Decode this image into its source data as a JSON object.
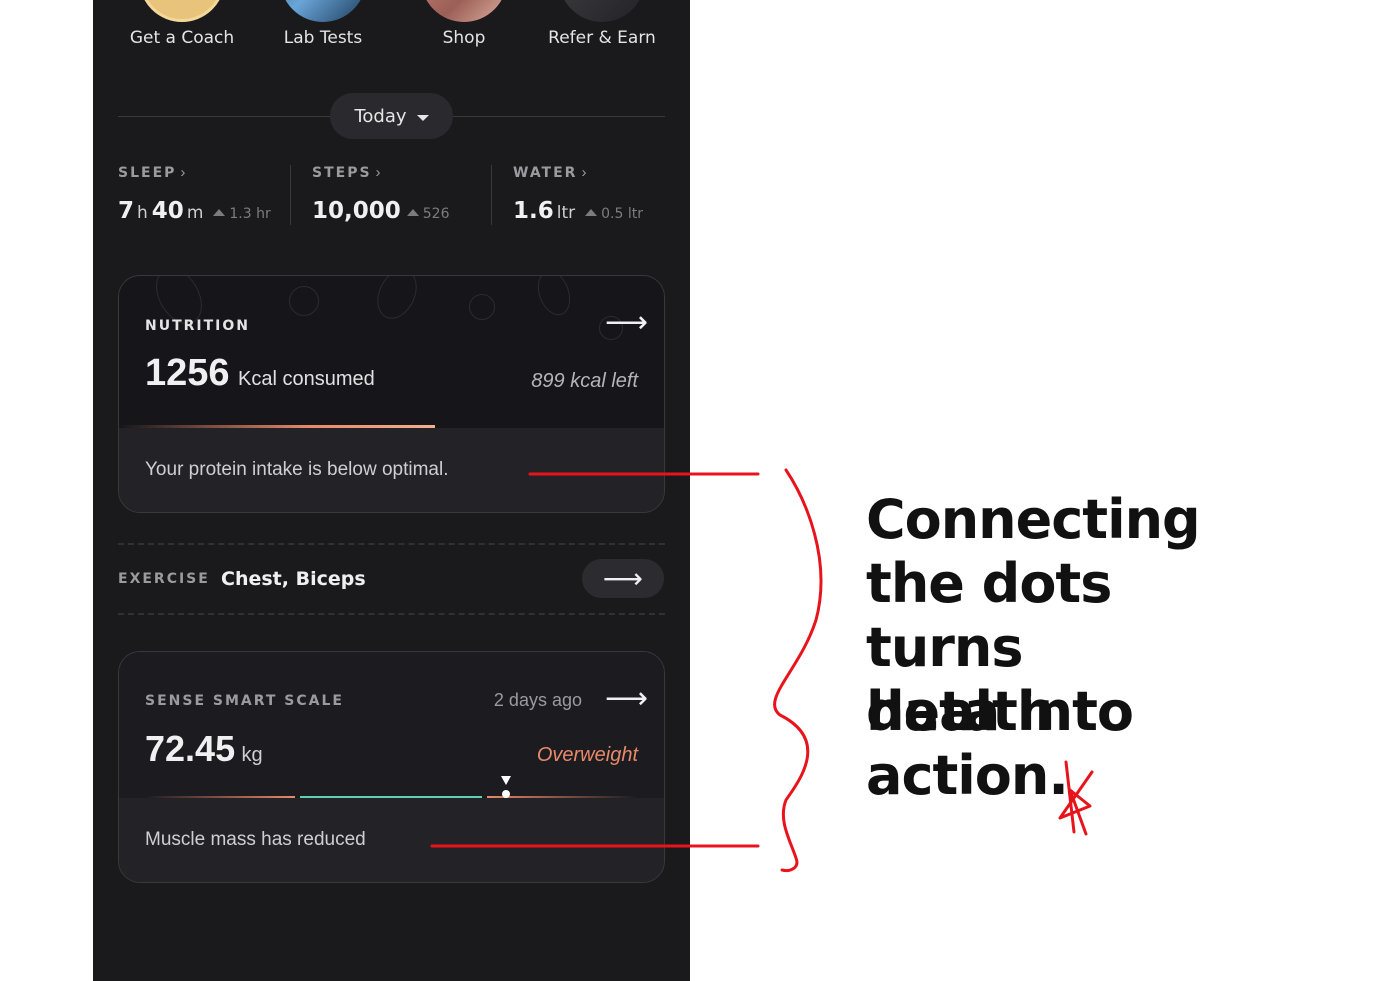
{
  "shortcuts": [
    {
      "label": "Get a Coach",
      "icon": "coach-avatar-icon",
      "color": "#e8c37b"
    },
    {
      "label": "Lab Tests",
      "icon": "lab-tests-icon",
      "color": "#4a7fb3"
    },
    {
      "label": "Shop",
      "icon": "shop-icon",
      "color": "#c87a6a"
    },
    {
      "label": "Refer & Earn",
      "icon": "refer-earn-icon",
      "color": "#3a3a3e"
    }
  ],
  "date_filter": {
    "label": "Today"
  },
  "stats": {
    "sleep": {
      "title": "SLEEP",
      "hours": "7",
      "h_unit": "h",
      "minutes": "40",
      "m_unit": "m",
      "delta": "1.3 hr"
    },
    "steps": {
      "title": "STEPS",
      "value": "10,000",
      "delta": "526"
    },
    "water": {
      "title": "WATER",
      "value": "1.6",
      "unit": "ltr",
      "delta": "0.5 ltr"
    }
  },
  "nutrition": {
    "title": "NUTRITION",
    "consumed": "1256",
    "consumed_label": "Kcal consumed",
    "left_label": "899 kcal left",
    "progress": 0.58,
    "insight": "Your protein intake is below optimal."
  },
  "exercise": {
    "title": "EXERCISE",
    "value": "Chest, Biceps"
  },
  "scale": {
    "title": "SENSE SMART SCALE",
    "when": "2 days ago",
    "weight": "72.45",
    "unit": "kg",
    "status": "Overweight",
    "insight": "Muscle mass has reduced"
  },
  "annotation": {
    "lines": [
      "Connecting",
      "the dots",
      "turns health",
      "data into",
      "action."
    ]
  },
  "colors": {
    "annotation_red": "#e8141c",
    "status_orange": "#e8896a",
    "healthy_green": "#5fd1b0"
  }
}
